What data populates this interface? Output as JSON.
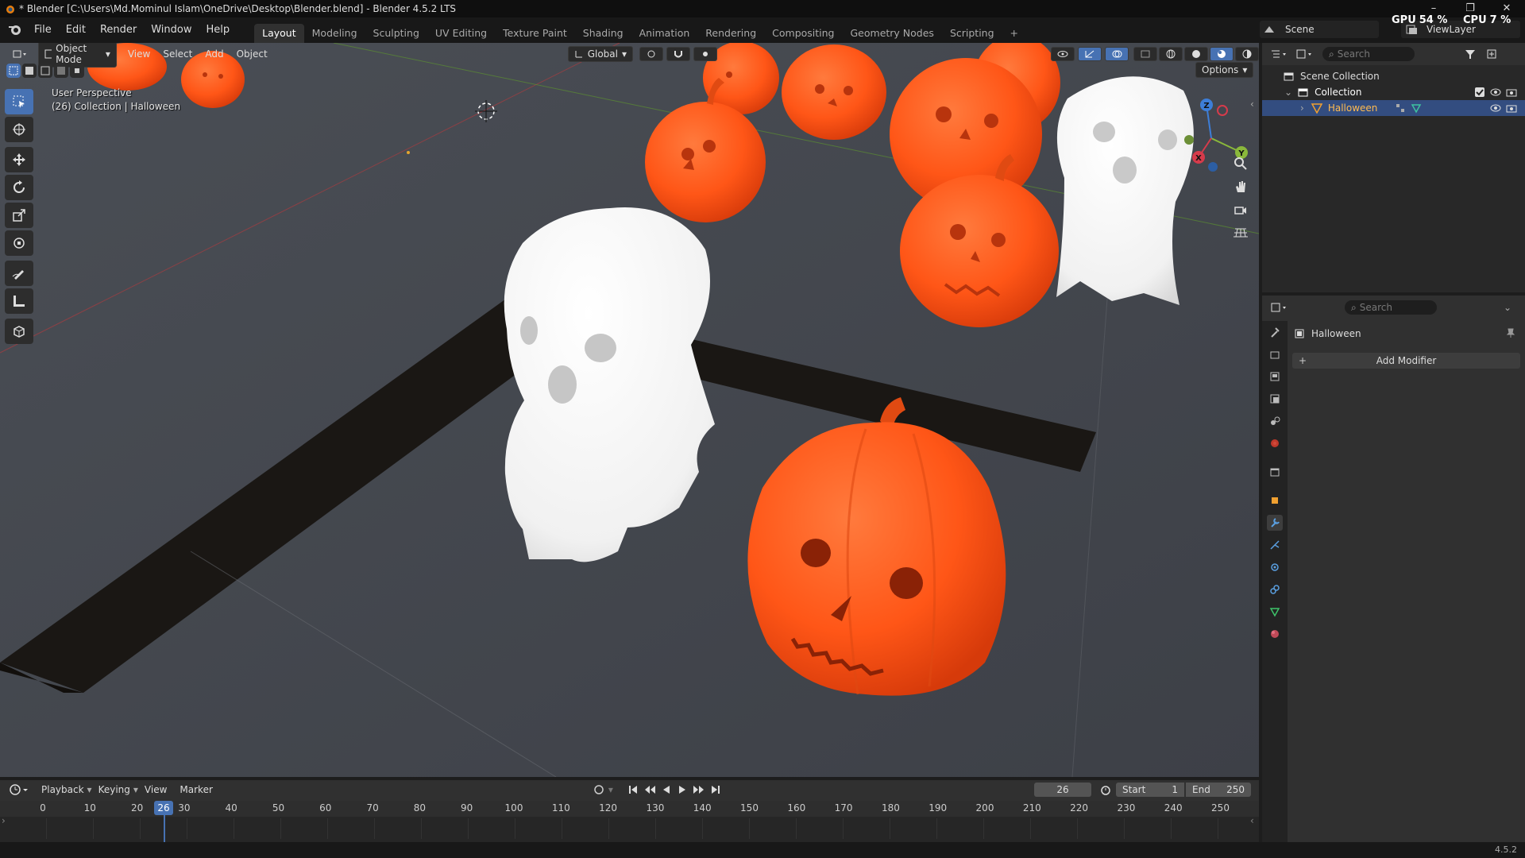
{
  "window": {
    "title": "* Blender [C:\\Users\\Md.Mominul Islam\\OneDrive\\Desktop\\Blender.blend] - Blender 4.5.2 LTS",
    "controls": [
      "–",
      "❐",
      "✕"
    ]
  },
  "menubar": {
    "items": [
      "File",
      "Edit",
      "Render",
      "Window",
      "Help"
    ],
    "workspaces": [
      "Layout",
      "Modeling",
      "Sculpting",
      "UV Editing",
      "Texture Paint",
      "Shading",
      "Animation",
      "Rendering",
      "Compositing",
      "Geometry Nodes",
      "Scripting"
    ],
    "active_workspace": "Layout",
    "add_tab": "+",
    "scene": "Scene",
    "view_layer": "ViewLayer",
    "gpu_label": "GPU",
    "gpu_value": "54 %",
    "cpu_label": "CPU",
    "cpu_value": "7 %"
  },
  "viewport": {
    "mode": "Object Mode",
    "menus": [
      "View",
      "Select",
      "Add",
      "Object"
    ],
    "orientation": "Global",
    "options": "Options",
    "overlay_line1": "User Perspective",
    "overlay_line2": "(26) Collection | Halloween",
    "axes": {
      "x": "X",
      "y": "Y",
      "z": "Z"
    },
    "tools": [
      "select-box-icon",
      "cursor-icon",
      "move-icon",
      "rotate-icon",
      "scale-icon",
      "transform-icon",
      "annotate-icon",
      "measure-icon",
      "add-cube-icon"
    ],
    "colors": {
      "pumpkin": "#ff5a1f",
      "ghost": "#f2f2f2",
      "floor": "#3c3c3c",
      "accent": "#4772b3"
    }
  },
  "outliner": {
    "search_placeholder": "Search",
    "scene_collection": "Scene Collection",
    "collection": "Collection",
    "object": "Halloween"
  },
  "properties": {
    "search_placeholder": "Search",
    "object_name": "Halloween",
    "add_modifier": "Add Modifier",
    "active_tab": "modifier"
  },
  "timeline": {
    "menus": [
      "Playback",
      "Keying",
      "View",
      "Marker"
    ],
    "current_frame": "26",
    "start_label": "Start",
    "start_value": "1",
    "end_label": "End",
    "end_value": "250",
    "ticks": [
      "0",
      "10",
      "20",
      "30",
      "40",
      "50",
      "60",
      "70",
      "80",
      "90",
      "100",
      "110",
      "120",
      "130",
      "140",
      "150",
      "160",
      "170",
      "180",
      "190",
      "200",
      "210",
      "220",
      "230",
      "240",
      "250"
    ],
    "playhead": "26"
  },
  "statusbar": {
    "version": "4.5.2"
  }
}
